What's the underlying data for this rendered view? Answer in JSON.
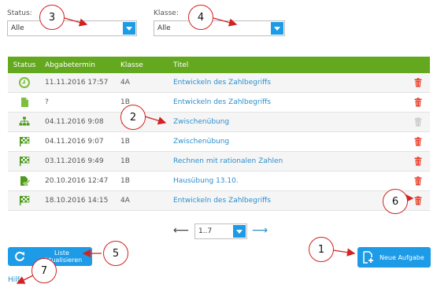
{
  "filters": {
    "status_label": "Status:",
    "status_value": "Alle",
    "klasse_label": "Klasse:",
    "klasse_value": "Alle"
  },
  "table": {
    "headers": [
      "Status",
      "Abgabetermin",
      "Klasse",
      "Titel"
    ],
    "rows": [
      {
        "status_icon": "clock-icon",
        "date": "11.11.2016 17:57",
        "klasse": "4A",
        "titel": "Entwickeln des Zahlbegriffs",
        "delete_enabled": true
      },
      {
        "status_icon": "document-icon",
        "date": "?",
        "klasse": "1B",
        "titel": "Entwickeln des Zahlbegriffs",
        "delete_enabled": true
      },
      {
        "status_icon": "sitemap-icon",
        "date": "04.11.2016 9:08",
        "klasse": "1",
        "titel": "Zwischenübung",
        "delete_enabled": false
      },
      {
        "status_icon": "checkered-flag-icon",
        "date": "04.11.2016 9:07",
        "klasse": "1B",
        "titel": "Zwischenübung",
        "delete_enabled": true
      },
      {
        "status_icon": "checkered-flag-icon",
        "date": "03.11.2016 9:49",
        "klasse": "1B",
        "titel": "Rechnen mit rationalen Zahlen",
        "delete_enabled": true
      },
      {
        "status_icon": "document-check-icon",
        "date": "20.10.2016 12:47",
        "klasse": "1B",
        "titel": "Hausübung 13.10.",
        "delete_enabled": true
      },
      {
        "status_icon": "checkered-flag-icon",
        "date": "18.10.2016 14:15",
        "klasse": "4A",
        "titel": "Entwickeln des Zahlbegriffs",
        "delete_enabled": true
      }
    ]
  },
  "pagination": {
    "prev_arrow": "⟵",
    "page_value": "1..7",
    "next_arrow": "⟶"
  },
  "buttons": {
    "refresh_label_line1": "Liste",
    "refresh_label_line2": "aktualisieren",
    "new_task_label": "Neue Aufgabe"
  },
  "help_link": "Hilfe",
  "callouts": [
    "1",
    "2",
    "3",
    "4",
    "5",
    "6",
    "7"
  ],
  "colors": {
    "accent_blue": "#1d9be6",
    "header_green": "#64a81f",
    "status_green": "#7cbf3a",
    "trash_red": "#e8412c",
    "callout_red": "#d22222"
  }
}
